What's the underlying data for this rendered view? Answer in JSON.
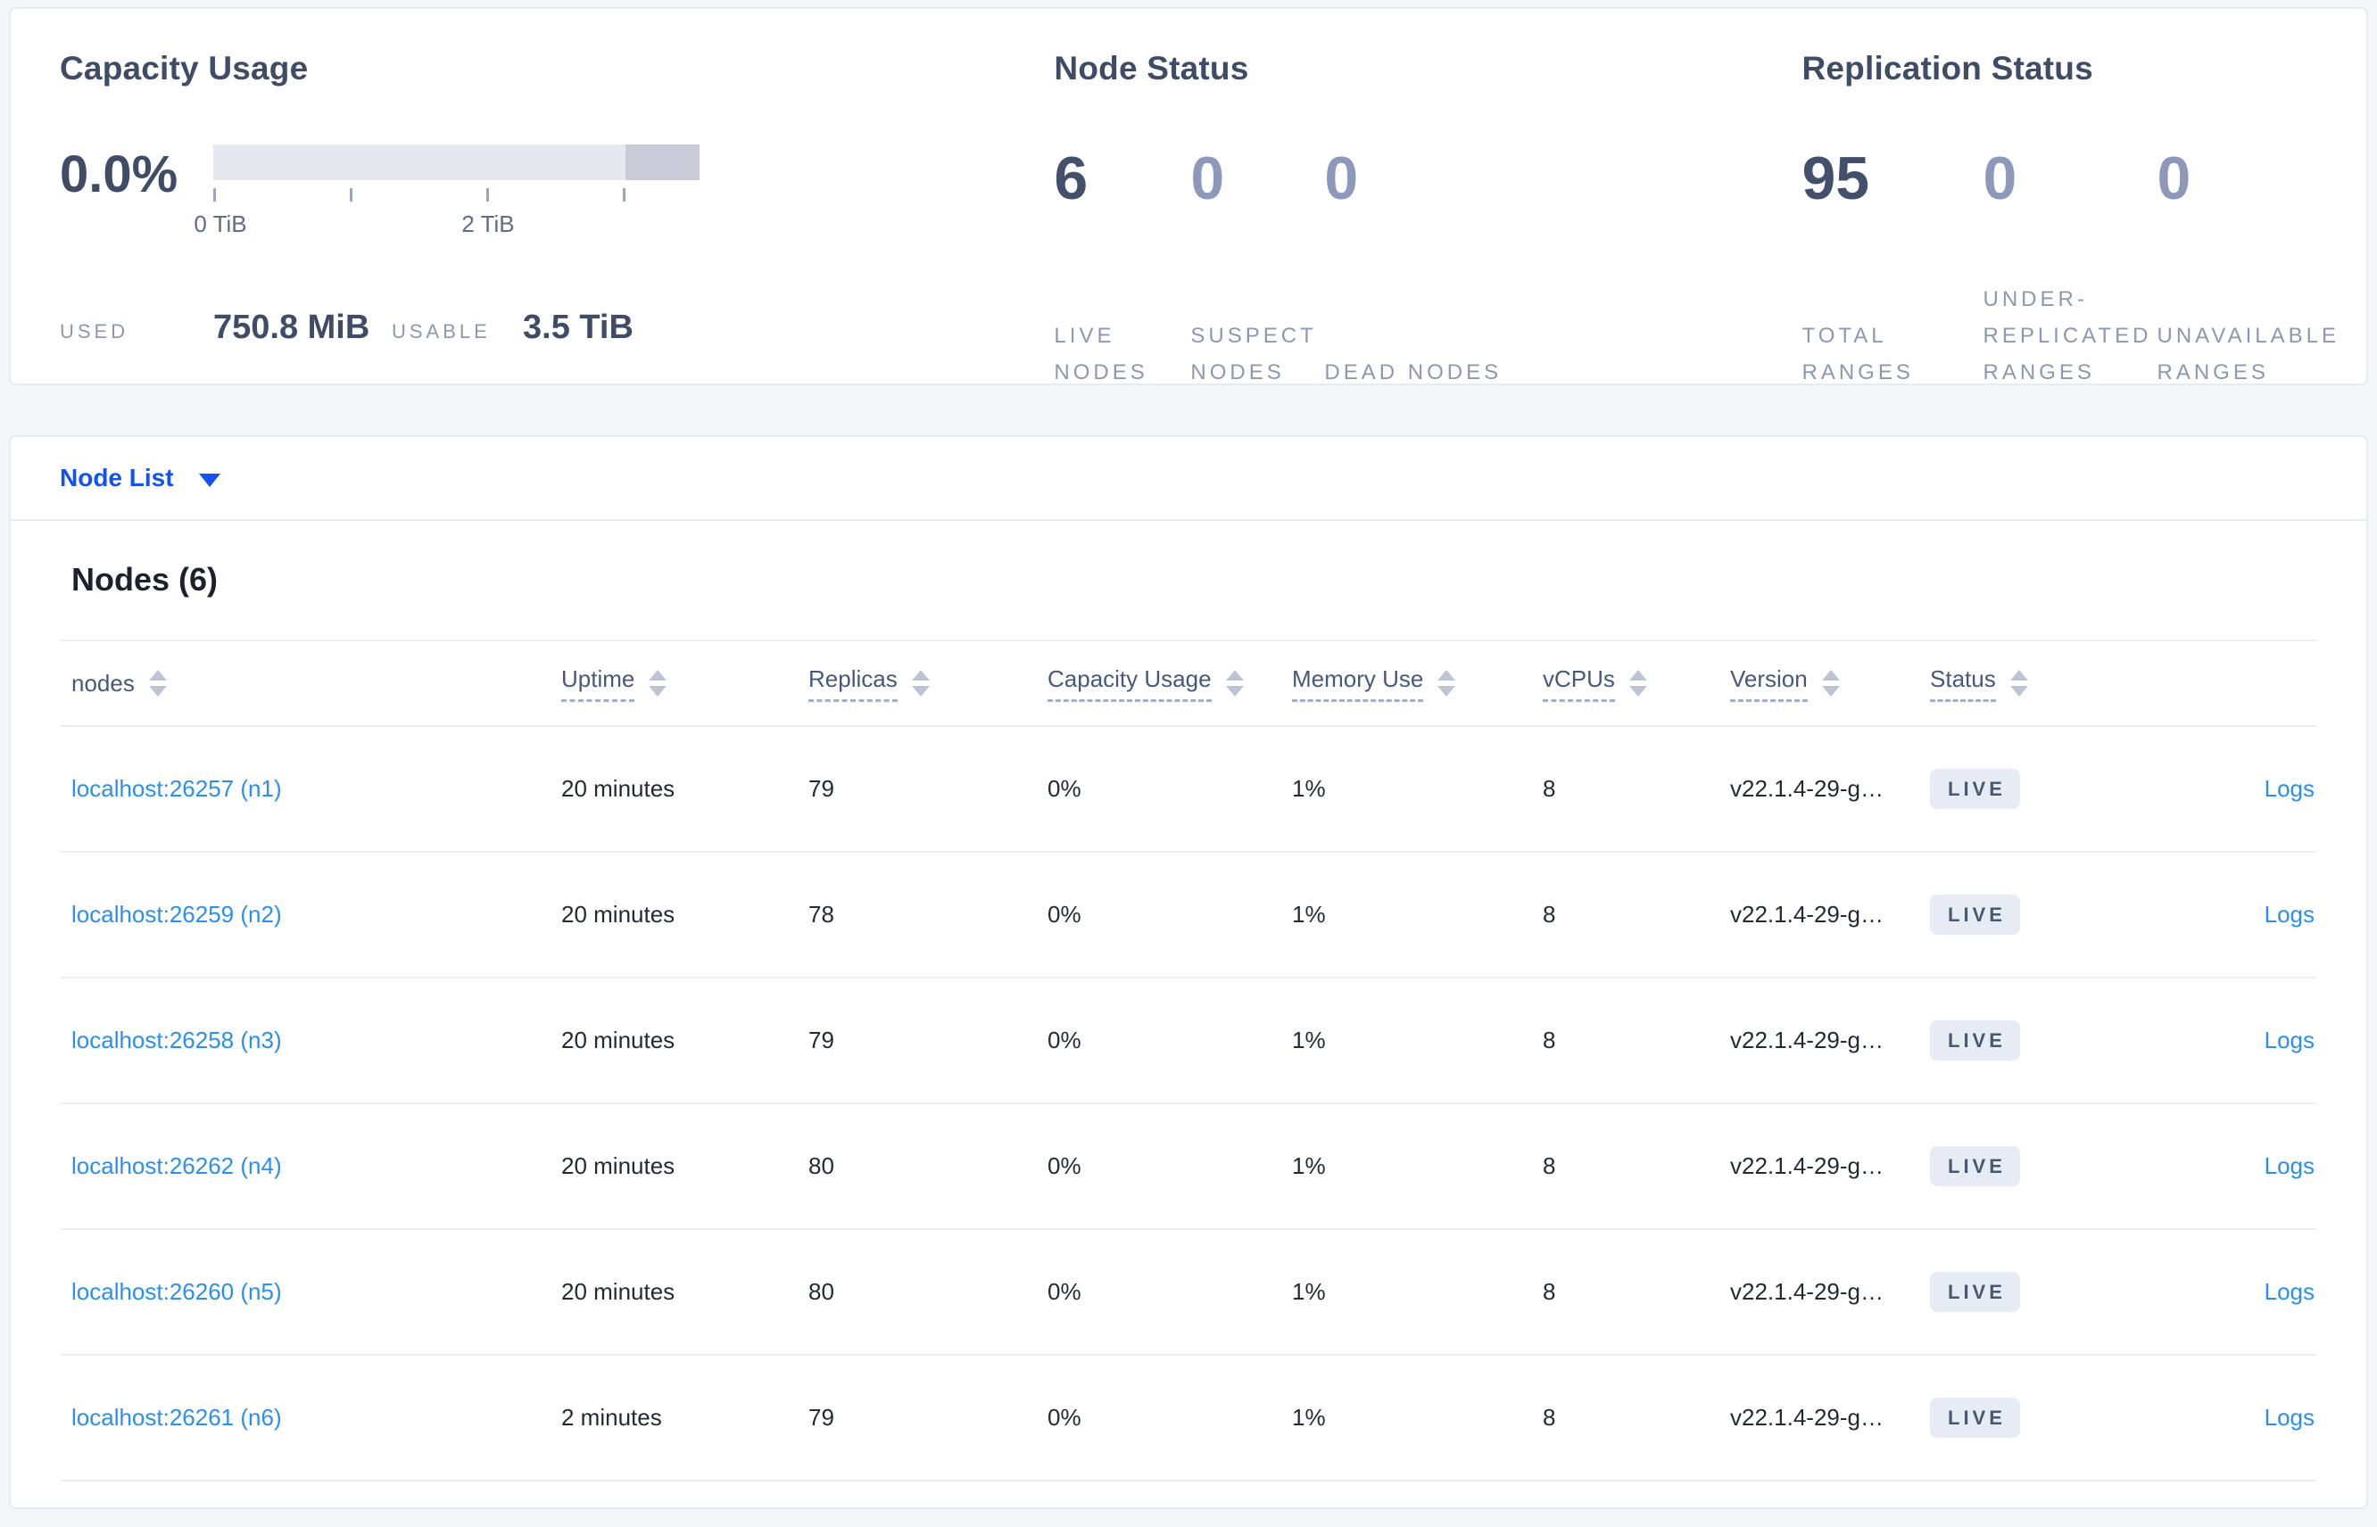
{
  "capacity_usage": {
    "title": "Capacity Usage",
    "percent": "0.0%",
    "axis_labels": [
      "0 TiB",
      "2 TiB"
    ],
    "used_label": "USED",
    "used_value": "750.8 MiB",
    "usable_label": "USABLE",
    "usable_value": "3.5 TiB"
  },
  "node_status": {
    "title": "Node Status",
    "stats": [
      {
        "value": "6",
        "label": "LIVE NODES"
      },
      {
        "value": "0",
        "label": "SUSPECT NODES"
      },
      {
        "value": "0",
        "label": "DEAD NODES"
      }
    ]
  },
  "replication_status": {
    "title": "Replication Status",
    "stats": [
      {
        "value": "95",
        "label": "TOTAL RANGES"
      },
      {
        "value": "0",
        "label": "UNDER-REPLICATED RANGES"
      },
      {
        "value": "0",
        "label": "UNAVAILABLE RANGES"
      }
    ]
  },
  "node_list": {
    "label": "Node List"
  },
  "nodes_table": {
    "heading": "Nodes (6)",
    "columns": [
      {
        "label": "nodes"
      },
      {
        "label": "Uptime"
      },
      {
        "label": "Replicas"
      },
      {
        "label": "Capacity Usage"
      },
      {
        "label": "Memory Use"
      },
      {
        "label": "vCPUs"
      },
      {
        "label": "Version"
      },
      {
        "label": "Status"
      }
    ],
    "rows": [
      {
        "address": "localhost:26257 (n1)",
        "uptime": "20 minutes",
        "replicas": "79",
        "capacity_usage": "0%",
        "memory_use": "1%",
        "vcpus": "8",
        "version": "v22.1.4-29-g…",
        "status": "LIVE",
        "logs_label": "Logs"
      },
      {
        "address": "localhost:26259 (n2)",
        "uptime": "20 minutes",
        "replicas": "78",
        "capacity_usage": "0%",
        "memory_use": "1%",
        "vcpus": "8",
        "version": "v22.1.4-29-g…",
        "status": "LIVE",
        "logs_label": "Logs"
      },
      {
        "address": "localhost:26258 (n3)",
        "uptime": "20 minutes",
        "replicas": "79",
        "capacity_usage": "0%",
        "memory_use": "1%",
        "vcpus": "8",
        "version": "v22.1.4-29-g…",
        "status": "LIVE",
        "logs_label": "Logs"
      },
      {
        "address": "localhost:26262 (n4)",
        "uptime": "20 minutes",
        "replicas": "80",
        "capacity_usage": "0%",
        "memory_use": "1%",
        "vcpus": "8",
        "version": "v22.1.4-29-g…",
        "status": "LIVE",
        "logs_label": "Logs"
      },
      {
        "address": "localhost:26260 (n5)",
        "uptime": "20 minutes",
        "replicas": "80",
        "capacity_usage": "0%",
        "memory_use": "1%",
        "vcpus": "8",
        "version": "v22.1.4-29-g…",
        "status": "LIVE",
        "logs_label": "Logs"
      },
      {
        "address": "localhost:26261 (n6)",
        "uptime": "2 minutes",
        "replicas": "79",
        "capacity_usage": "0%",
        "memory_use": "1%",
        "vcpus": "8",
        "version": "v22.1.4-29-g…",
        "status": "LIVE",
        "logs_label": "Logs"
      }
    ]
  },
  "colors": {
    "page_background": "#f4f6fa",
    "primary_blue": "#1352ef",
    "link_blue": "#2b8ff2",
    "metric_dark": "#42506b",
    "metric_muted": "#8d99ba",
    "gauge_fill": "#e6e8f0",
    "gauge_reserved": "#c9ccd8",
    "badge_background": "#e7ebf3",
    "badge_text": "#475872"
  }
}
